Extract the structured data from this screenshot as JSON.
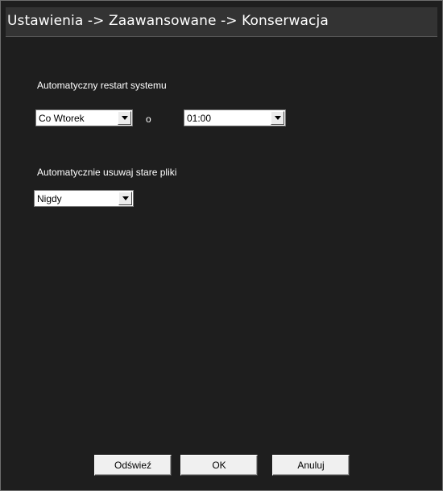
{
  "window": {
    "title": "Ustawienia -> Zaawansowane -> Konserwacja"
  },
  "restart": {
    "label": "Automatyczny restart systemu",
    "day_value": "Co Wtorek",
    "connector": "o",
    "time_value": "01:00"
  },
  "cleanup": {
    "label": "Automatycznie usuwaj stare pliki",
    "value": "Nigdy"
  },
  "buttons": {
    "refresh": "Odświeź",
    "ok": "OK",
    "cancel": "Anuluj"
  },
  "colors": {
    "background": "#1e1e1e",
    "titlebar": "#333333",
    "text": "#ffffff"
  }
}
